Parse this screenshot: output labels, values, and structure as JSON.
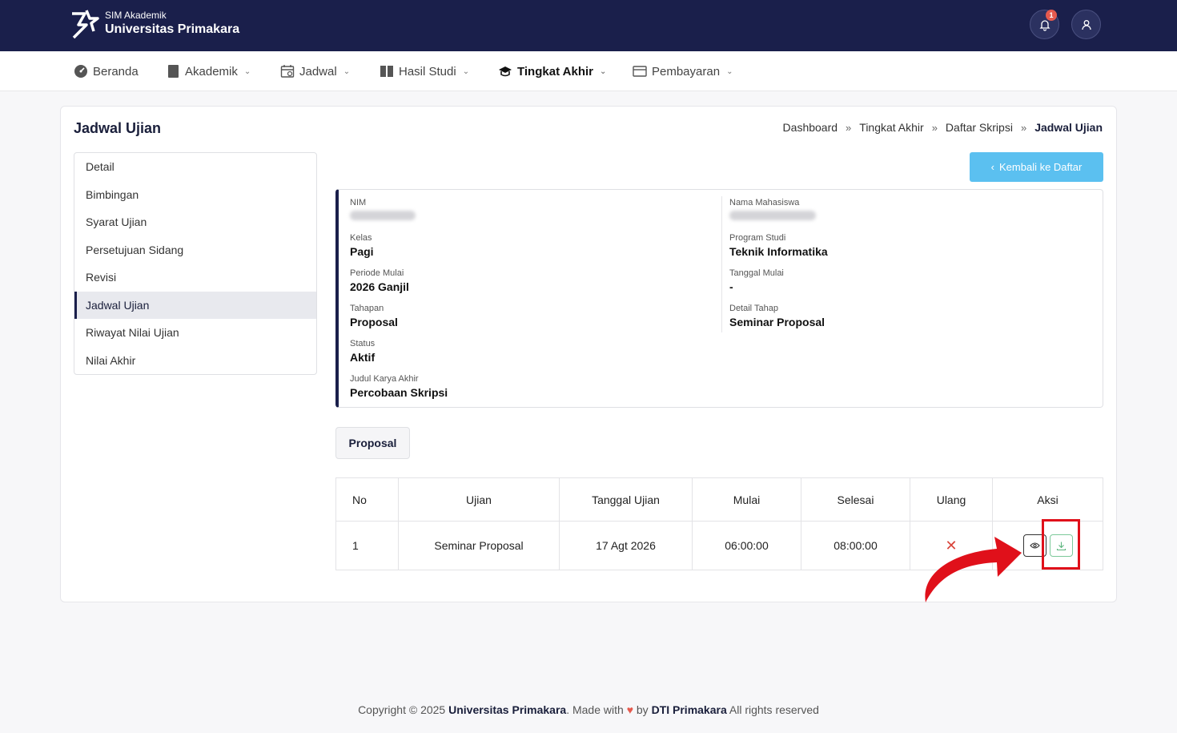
{
  "header": {
    "app_small": "SIM Akademik",
    "app_name": "Universitas Primakara",
    "notification_count": "1"
  },
  "nav": [
    {
      "label": "Beranda",
      "icon": "dashboard-icon"
    },
    {
      "label": "Akademik",
      "icon": "book-icon"
    },
    {
      "label": "Jadwal",
      "icon": "calendar-icon"
    },
    {
      "label": "Hasil Studi",
      "icon": "book-open-icon"
    },
    {
      "label": "Tingkat Akhir",
      "icon": "graduation-cap-icon"
    },
    {
      "label": "Pembayaran",
      "icon": "wallet-icon"
    }
  ],
  "page": {
    "title": "Jadwal Ujian",
    "breadcrumb": [
      "Dashboard",
      "Tingkat Akhir",
      "Daftar Skripsi",
      "Jadwal Ujian"
    ],
    "back_button": "Kembali ke Daftar"
  },
  "side_menu": [
    "Detail",
    "Bimbingan",
    "Syarat Ujian",
    "Persetujuan Sidang",
    "Revisi",
    "Jadwal Ujian",
    "Riwayat Nilai Ujian",
    "Nilai Akhir"
  ],
  "info": {
    "nim_label": "NIM",
    "nama_label": "Nama Mahasiswa",
    "kelas_label": "Kelas",
    "kelas": "Pagi",
    "prodi_label": "Program Studi",
    "prodi": "Teknik Informatika",
    "periode_label": "Periode Mulai",
    "periode": "2026 Ganjil",
    "tgl_mulai_label": "Tanggal Mulai",
    "tgl_mulai": "-",
    "tahapan_label": "Tahapan",
    "tahapan": "Proposal",
    "detail_label": "Detail Tahap",
    "detail": "Seminar Proposal",
    "status_label": "Status",
    "status": "Aktif",
    "judul_label": "Judul Karya Akhir",
    "judul": "Percobaan Skripsi"
  },
  "tab": "Proposal",
  "table": {
    "headers": [
      "No",
      "Ujian",
      "Tanggal Ujian",
      "Mulai",
      "Selesai",
      "Ulang",
      "Aksi"
    ],
    "rows": [
      {
        "no": "1",
        "ujian": "Seminar Proposal",
        "tanggal": "17 Agt 2026",
        "mulai": "06:00:00",
        "selesai": "08:00:00",
        "ulang": "✕"
      }
    ]
  },
  "footer": {
    "prefix": "Copyright © 2025 ",
    "org": "Universitas Primakara",
    "made": ". Made with ",
    "by": " by ",
    "team": "DTI Primakara",
    "suffix": " All rights reserved"
  },
  "colors": {
    "header_bg": "#1a1f4b",
    "accent_button": "#5bc0f0",
    "annotation_red": "#e0101a"
  }
}
